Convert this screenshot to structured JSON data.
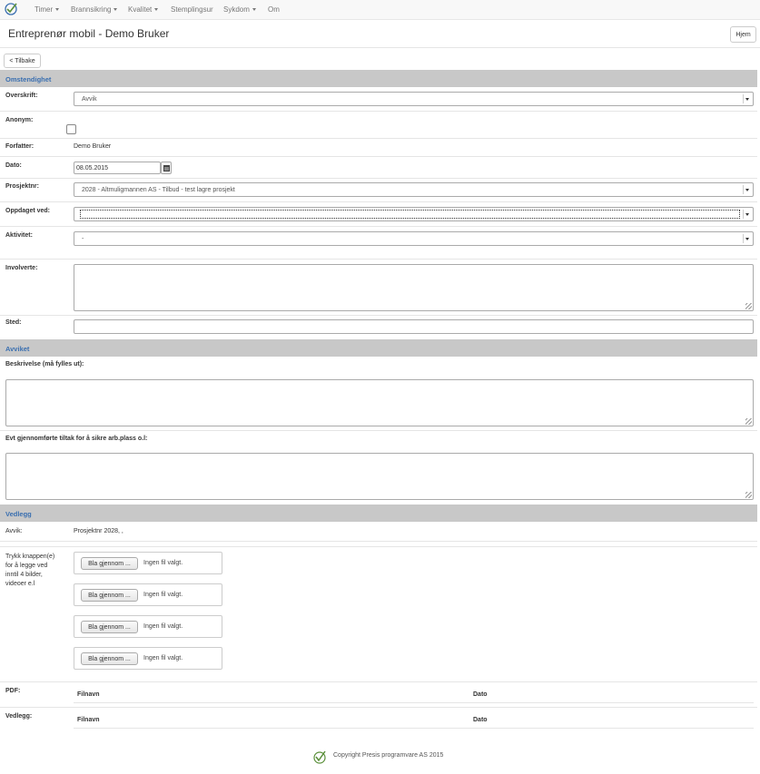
{
  "nav": {
    "items": [
      {
        "label": "Timer",
        "dropdown": true
      },
      {
        "label": "Brannsikring",
        "dropdown": true
      },
      {
        "label": "Kvalitet",
        "dropdown": true
      },
      {
        "label": "Stemplingsur",
        "dropdown": false
      },
      {
        "label": "Sykdom",
        "dropdown": true
      },
      {
        "label": "Om",
        "dropdown": false
      }
    ],
    "logo_icon": "check-circle-logo-icon"
  },
  "header": {
    "title": "Entreprenør mobil - Demo Bruker",
    "home_label": "Hjem"
  },
  "back_label": "< Tilbake",
  "sections": {
    "omstendighet": "Omstendighet",
    "avviket": "Avviket",
    "vedlegg": "Vedlegg"
  },
  "form": {
    "overskrift": {
      "label": "Overskrift:",
      "value": "Avvik"
    },
    "anonym": {
      "label": "Anonym:",
      "checked": false
    },
    "forfatter": {
      "label": "Forfatter:",
      "value": "Demo Bruker"
    },
    "dato": {
      "label": "Dato:",
      "value": "08.05.2015",
      "icon": "calendar-icon"
    },
    "prosjektnr": {
      "label": "Prosjektnr:",
      "value": "2028 - Altmuligmannen AS - Tilbud - test lagre prosjekt"
    },
    "oppdaget_ved": {
      "label": "Oppdaget ved:",
      "value": ""
    },
    "aktivitet": {
      "label": "Aktivitet:",
      "value": "-"
    },
    "involverte": {
      "label": "Involverte:",
      "value": ""
    },
    "sted": {
      "label": "Sted:",
      "value": ""
    },
    "beskrivelse": {
      "label": "Beskrivelse (må fylles ut):",
      "value": ""
    },
    "tiltak": {
      "label": "Evt gjennomførte tiltak for å sikre arb.plass o.l:",
      "value": ""
    }
  },
  "vedlegg": {
    "avvik_label": "Avvik:",
    "avvik_value": "Prosjektnr 2028, ,",
    "instructions": "Trykk knappen(e) for å legge ved inntil 4 bilder, videoer e.l",
    "file_inputs": [
      {
        "button": "Bla gjennom ...",
        "status": "Ingen fil valgt."
      },
      {
        "button": "Bla gjennom ...",
        "status": "Ingen fil valgt."
      },
      {
        "button": "Bla gjennom ...",
        "status": "Ingen fil valgt."
      },
      {
        "button": "Bla gjennom ...",
        "status": "Ingen fil valgt."
      }
    ],
    "pdf_label": "PDF:",
    "vedlegg_label": "Vedlegg:",
    "col_filnavn": "Filnavn",
    "col_dato": "Dato"
  },
  "footer": {
    "copyright": "Copyright Presis programvare AS 2015",
    "logo_icon": "check-circle-logo-icon"
  },
  "colors": {
    "section_bg": "#c8c8c8",
    "section_text": "#3a6fb0",
    "navbar_bg": "#f8f8f8"
  }
}
